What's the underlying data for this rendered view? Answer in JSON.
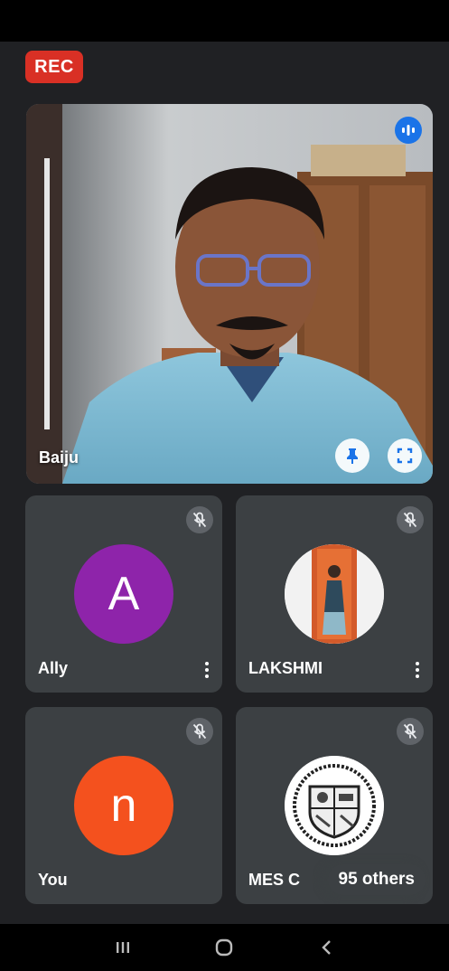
{
  "recording": {
    "label": "REC",
    "color": "#d93025"
  },
  "main_video": {
    "name": "Baiju",
    "speaking_icon": "audio-wave-icon",
    "pin_icon": "pin-icon",
    "fullscreen_icon": "fullscreen-icon"
  },
  "participants": [
    {
      "name": "Ally",
      "avatar_letter": "A",
      "avatar_color": "#8e24aa",
      "muted": true,
      "has_menu": true
    },
    {
      "name": "LAKSHMI",
      "avatar_type": "photo",
      "muted": true,
      "has_menu": true
    },
    {
      "name": "You",
      "avatar_letter": "n",
      "avatar_color": "#f4511e",
      "muted": true
    },
    {
      "name": "MES C",
      "avatar_type": "logo",
      "muted": true,
      "others_label": "95 others"
    }
  ],
  "nav": {
    "recents_icon": "recents-icon",
    "home_icon": "home-icon",
    "back_icon": "back-icon"
  }
}
